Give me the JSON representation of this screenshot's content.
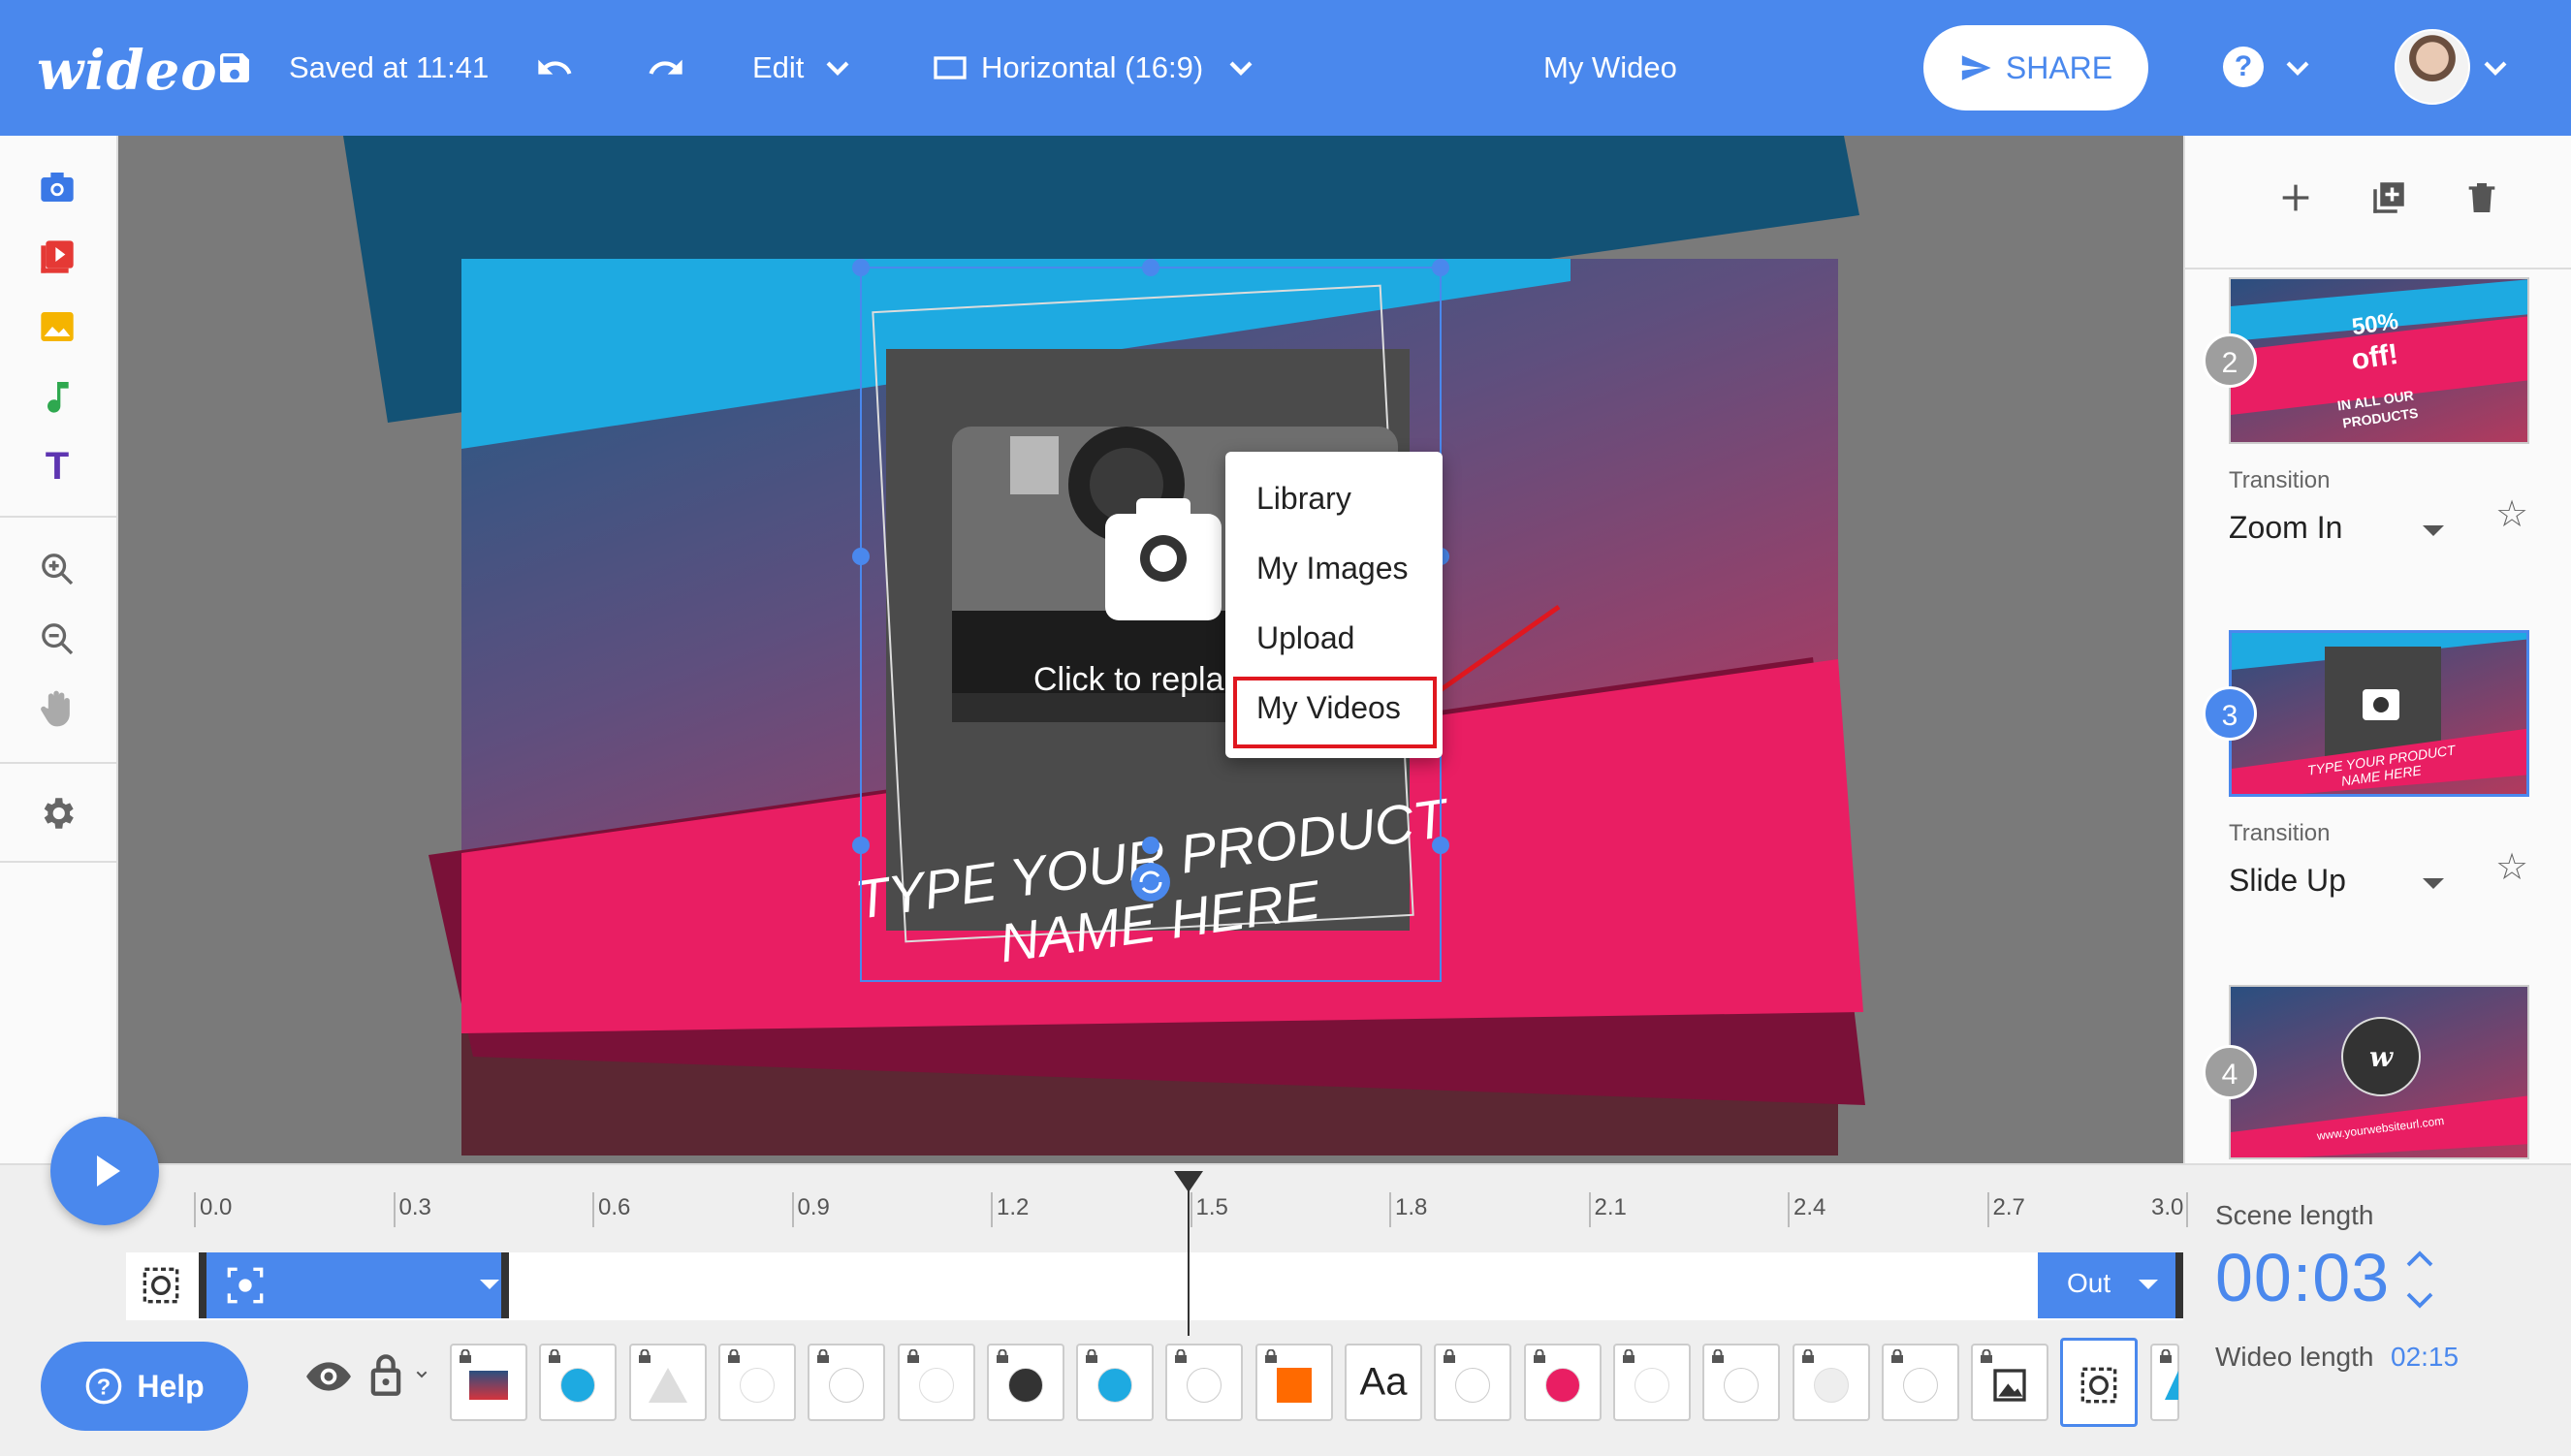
{
  "topbar": {
    "logo": "wideo",
    "saved_text": "Saved at 11:41",
    "edit_label": "Edit",
    "format_label": "Horizontal (16:9)",
    "title": "My Wideo",
    "share_label": "SHARE",
    "help_symbol": "?"
  },
  "left_tools": [
    {
      "icon": "camera-icon",
      "color": "#3a78e6"
    },
    {
      "icon": "video-icon",
      "color": "#e53935"
    },
    {
      "icon": "image-icon",
      "color": "#f5b400"
    },
    {
      "icon": "music-icon",
      "color": "#2fa84f"
    },
    {
      "icon": "text-icon",
      "color": "#5e35b1",
      "glyph": "T"
    },
    {
      "icon": "zoom-in-icon"
    },
    {
      "icon": "zoom-out-icon"
    },
    {
      "icon": "hand-icon"
    },
    {
      "icon": "settings-icon"
    }
  ],
  "canvas": {
    "placeholder_text": "Click to repla",
    "headline_line1": "TYPE YOUR PRODUCT",
    "headline_line2": "NAME HERE"
  },
  "context_menu": {
    "items": [
      "Library",
      "My Images",
      "Upload",
      "My Videos"
    ],
    "highlighted": "My Videos"
  },
  "right_panel": {
    "scenes": [
      {
        "number": "2",
        "thumb_line1": "50%",
        "thumb_line2": "off!",
        "thumb_line3": "IN ALL OUR",
        "thumb_line4": "PRODUCTS",
        "transition_label": "Transition",
        "transition": "Zoom In"
      },
      {
        "number": "3",
        "thumb_line1": "TYPE YOUR PRODUCT",
        "thumb_line2": "NAME HERE",
        "transition_label": "Transition",
        "transition": "Slide Up",
        "selected": true
      },
      {
        "number": "4",
        "thumb_line1": "www.yourwebsiteurl.com"
      }
    ]
  },
  "timeline": {
    "ticks": [
      "0.0",
      "0.3",
      "0.6",
      "0.9",
      "1.2",
      "1.5",
      "1.8",
      "2.1",
      "2.4",
      "2.7",
      "3.0"
    ],
    "playhead_value": 1.5,
    "out_label": "Out",
    "help_label": "Help",
    "scene_length_label": "Scene length",
    "scene_length": "00:03",
    "wideo_length_label": "Wideo length",
    "wideo_length": "02:15",
    "text_layer_glyph": "Aa"
  },
  "colors": {
    "brand_blue": "#4a88ed",
    "pink_band": "#e91e63",
    "cyan_band": "#1eaae1",
    "highlight_red": "#e0171f"
  }
}
